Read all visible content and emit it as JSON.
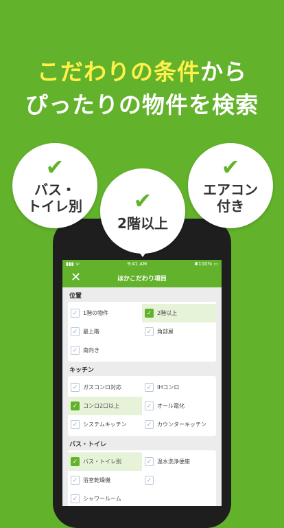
{
  "headline": {
    "line1_highlight": "こだわりの条件",
    "line1_rest": "から",
    "line2": "ぴったりの物件を検索"
  },
  "bubbles": {
    "check_icon": "✔",
    "left": "バス・\nトイレ別",
    "center": "2階以上",
    "right": "エアコン\n付き"
  },
  "phone": {
    "status": {
      "left": "▮▮▮ ᯤ",
      "time": "9:41 AM",
      "battery": "✱100% ▭"
    },
    "nav": {
      "close_icon": "✕",
      "title": "ほかこだわり項目"
    },
    "sections": [
      {
        "title": "位置",
        "options": [
          {
            "label": "1階の物件",
            "checked": false
          },
          {
            "label": "2階以上",
            "checked": true
          },
          {
            "label": "最上階",
            "checked": false
          },
          {
            "label": "角部屋",
            "checked": false
          },
          {
            "label": "南向き",
            "checked": false
          }
        ]
      },
      {
        "title": "キッチン",
        "options": [
          {
            "label": "ガスコンロ対応",
            "checked": false
          },
          {
            "label": "IHコンロ",
            "checked": false
          },
          {
            "label": "コンロ2口以上",
            "checked": true
          },
          {
            "label": "オール電化",
            "checked": false
          },
          {
            "label": "システムキッチン",
            "checked": false
          },
          {
            "label": "カウンターキッチン",
            "checked": false
          }
        ]
      },
      {
        "title": "バス・トイレ",
        "options": [
          {
            "label": "バス・トイレ別",
            "checked": true
          },
          {
            "label": "温水洗浄便座",
            "checked": false
          },
          {
            "label": "浴室乾燥機",
            "checked": false
          },
          {
            "label": "",
            "checked": false
          },
          {
            "label": "シャワールーム",
            "checked": false
          }
        ]
      }
    ]
  },
  "colors": {
    "brand_green": "#62b22c",
    "highlight_yellow": "#fff04a",
    "selected_bg": "#e6f3d9"
  }
}
